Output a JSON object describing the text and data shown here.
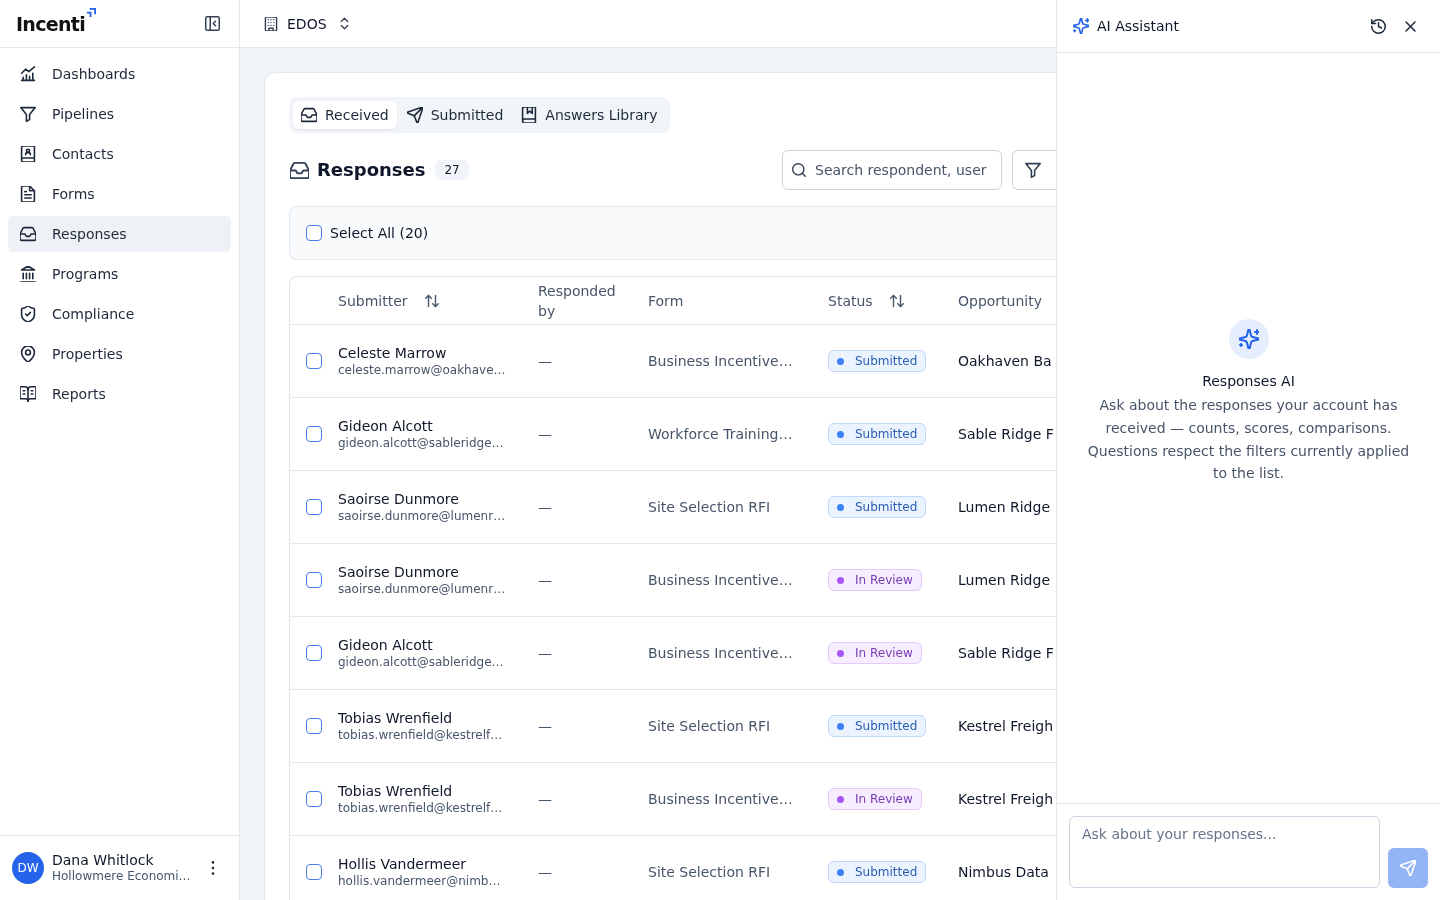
{
  "sidebar": {
    "logo": "Incenti",
    "nav": [
      {
        "label": "Dashboards",
        "selected": false
      },
      {
        "label": "Pipelines",
        "selected": false
      },
      {
        "label": "Contacts",
        "selected": false
      },
      {
        "label": "Forms",
        "selected": false
      },
      {
        "label": "Responses",
        "selected": true
      },
      {
        "label": "Programs",
        "selected": false
      },
      {
        "label": "Compliance",
        "selected": false
      },
      {
        "label": "Properties",
        "selected": false
      },
      {
        "label": "Reports",
        "selected": false
      }
    ],
    "user": {
      "initials": "DW",
      "name": "Dana Whitlock",
      "organization": "Hollowmere Economi…"
    }
  },
  "topbar": {
    "workspace": "EDOS"
  },
  "tabs": [
    {
      "label": "Received",
      "selected": true
    },
    {
      "label": "Submitted",
      "selected": false
    },
    {
      "label": "Answers Library",
      "selected": false
    }
  ],
  "responses": {
    "title": "Responses",
    "count": "27",
    "search": {
      "placeholder": "Search respondent, user"
    }
  },
  "select_all": {
    "label": "Select All (20)",
    "checked": false
  },
  "table": {
    "columns": [
      {
        "label": "Submitter",
        "sortable": true
      },
      {
        "label": "Responded by",
        "sortable": false
      },
      {
        "label": "Form",
        "sortable": false
      },
      {
        "label": "Status",
        "sortable": true
      },
      {
        "label": "Opportunity",
        "sortable": false
      }
    ],
    "rows": [
      {
        "checked": false,
        "name": "Celeste Marrow",
        "email": "celeste.marrow@oakhave…",
        "responded_by": "—",
        "form": "Business Incentive…",
        "status": {
          "label": "Submitted",
          "color": "#3b82f6"
        },
        "opportunity": "Oakhaven Ba"
      },
      {
        "checked": false,
        "name": "Gideon Alcott",
        "email": "gideon.alcott@sableridge…",
        "responded_by": "—",
        "form": "Workforce Training…",
        "status": {
          "label": "Submitted",
          "color": "#3b82f6"
        },
        "opportunity": "Sable Ridge F"
      },
      {
        "checked": false,
        "name": "Saoirse Dunmore",
        "email": "saoirse.dunmore@lumenr…",
        "responded_by": "—",
        "form": "Site Selection RFI",
        "status": {
          "label": "Submitted",
          "color": "#3b82f6"
        },
        "opportunity": "Lumen Ridge"
      },
      {
        "checked": false,
        "name": "Saoirse Dunmore",
        "email": "saoirse.dunmore@lumenr…",
        "responded_by": "—",
        "form": "Business Incentive…",
        "status": {
          "label": "In Review",
          "color": "#a855f7"
        },
        "opportunity": "Lumen Ridge"
      },
      {
        "checked": false,
        "name": "Gideon Alcott",
        "email": "gideon.alcott@sableridge…",
        "responded_by": "—",
        "form": "Business Incentive…",
        "status": {
          "label": "In Review",
          "color": "#a855f7"
        },
        "opportunity": "Sable Ridge F"
      },
      {
        "checked": false,
        "name": "Tobias Wrenfield",
        "email": "tobias.wrenfield@kestrelf…",
        "responded_by": "—",
        "form": "Site Selection RFI",
        "status": {
          "label": "Submitted",
          "color": "#3b82f6"
        },
        "opportunity": "Kestrel Freigh"
      },
      {
        "checked": false,
        "name": "Tobias Wrenfield",
        "email": "tobias.wrenfield@kestrelf…",
        "responded_by": "—",
        "form": "Business Incentive…",
        "status": {
          "label": "In Review",
          "color": "#a855f7"
        },
        "opportunity": "Kestrel Freigh"
      },
      {
        "checked": false,
        "name": "Hollis Vandermeer",
        "email": "hollis.vandermeer@nimb…",
        "responded_by": "—",
        "form": "Site Selection RFI",
        "status": {
          "label": "Submitted",
          "color": "#3b82f6"
        },
        "opportunity": "Nimbus Data"
      }
    ]
  },
  "assistant": {
    "title": "AI Assistant",
    "empty_title": "Responses AI",
    "empty_text": "Ask about the responses your account has received — counts, scores, comparisons. Questions respect the filters currently applied to the list.",
    "input": {
      "placeholder": "Ask about your responses..."
    },
    "send_button": {
      "disabled": true
    }
  }
}
